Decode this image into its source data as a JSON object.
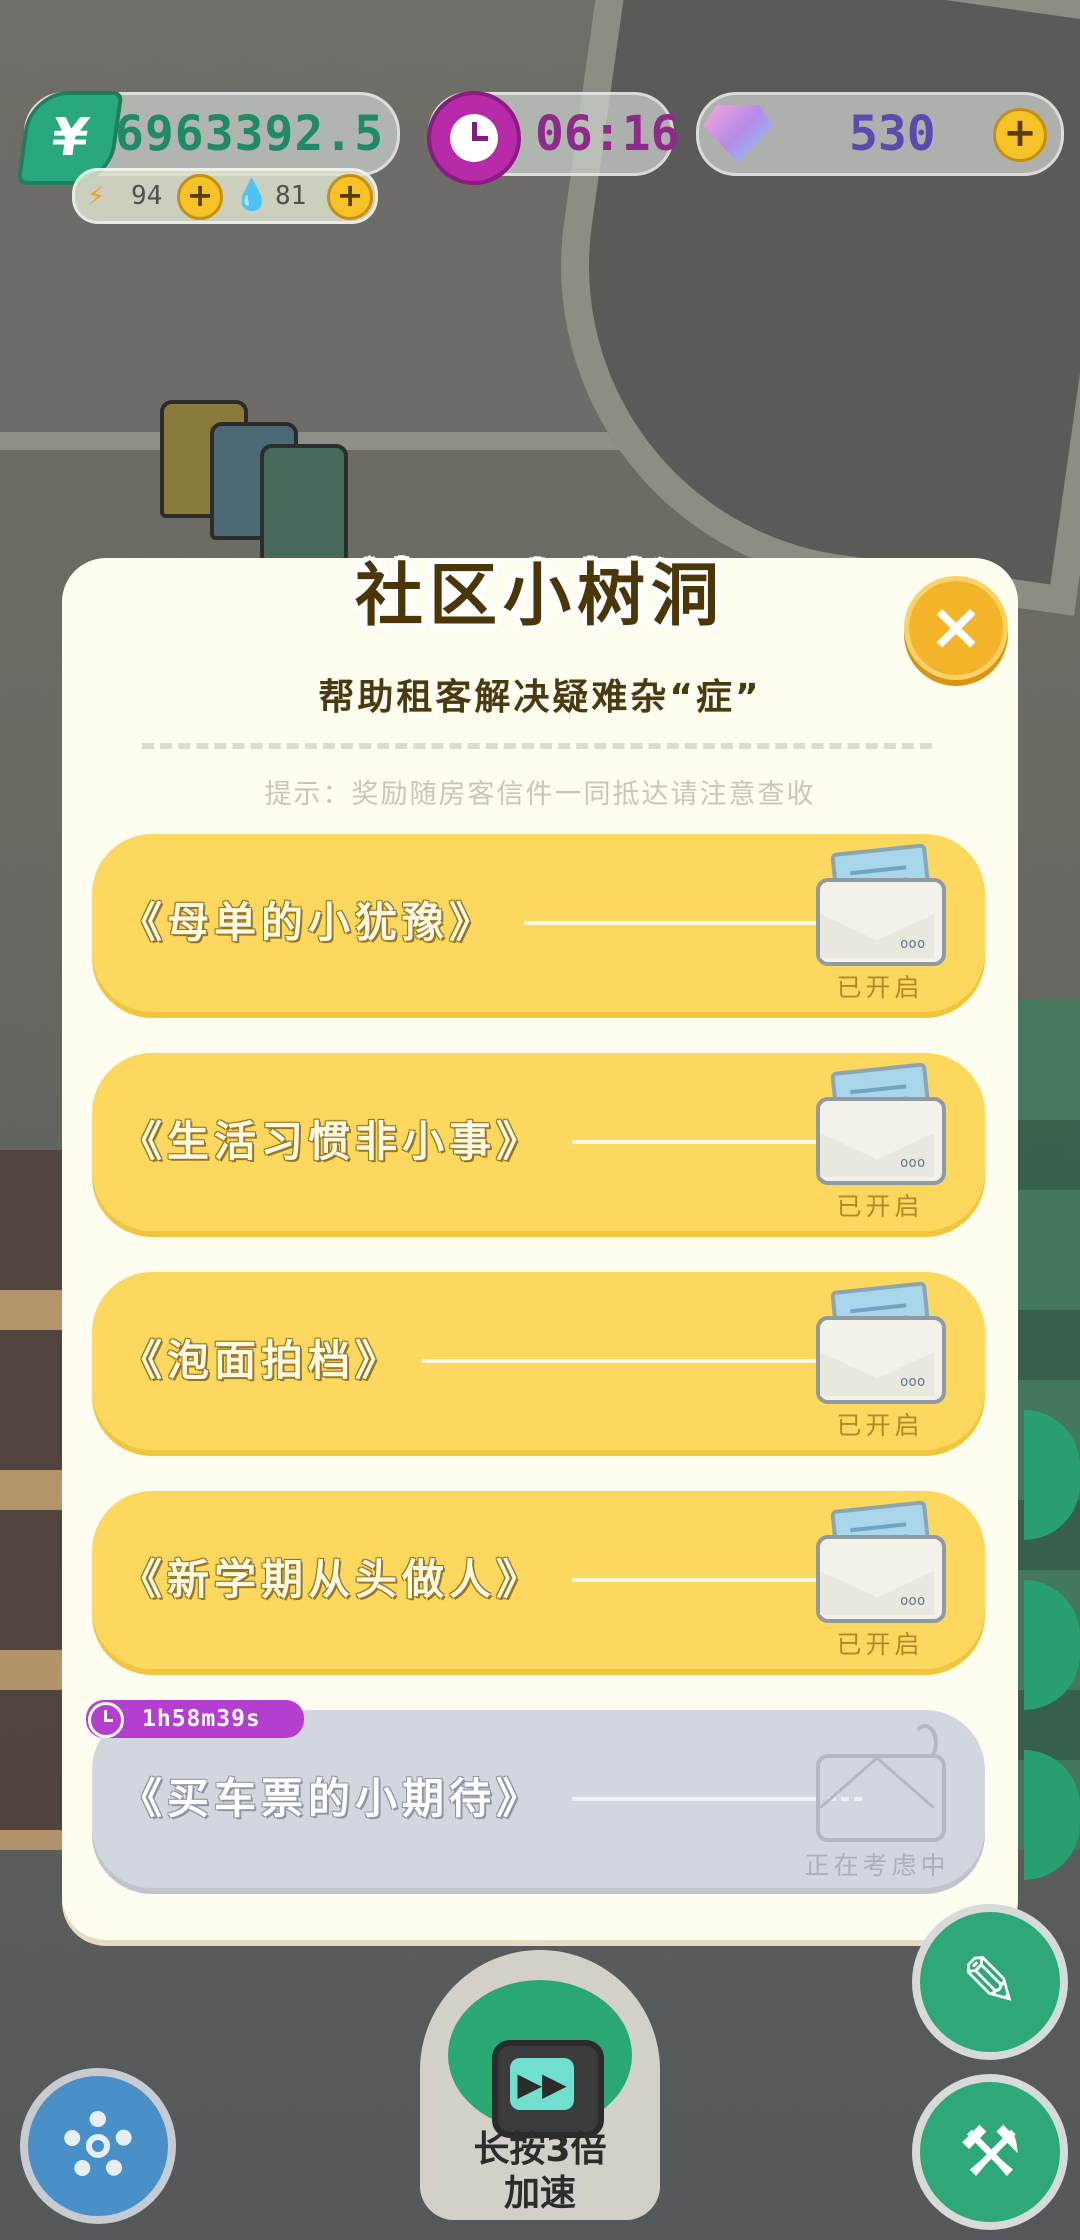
{
  "hud": {
    "money": {
      "icon": "yuan-icon",
      "symbol": "¥",
      "value": "6963392.5"
    },
    "timer": {
      "icon": "clock-icon",
      "value": "06:16"
    },
    "gems": {
      "icon": "gem-icon",
      "value": "530"
    },
    "energy": {
      "icon": "lightning-icon",
      "value": "94"
    },
    "water": {
      "icon": "water-drop-icon",
      "value": "81"
    },
    "plus_label": "+"
  },
  "modal": {
    "title": "社区小树洞",
    "close_label": "×",
    "subtitle": "帮助租客解决疑难杂“症”",
    "hint": "提示：奖励随房客信件一同抵达请注意查收",
    "letters": [
      {
        "title": "《母单的小犹豫》",
        "status": "已开启",
        "state": "opened"
      },
      {
        "title": "《生活习惯非小事》",
        "status": "已开启",
        "state": "opened"
      },
      {
        "title": "《泡面拍档》",
        "status": "已开启",
        "state": "opened"
      },
      {
        "title": "《新学期从头做人》",
        "status": "已开启",
        "state": "opened"
      },
      {
        "title": "《买车票的小期待》",
        "status": "正在考虑中",
        "state": "pending",
        "timer": "1h58m39s"
      }
    ],
    "envelope_dots": "ooo"
  },
  "controls": {
    "settings_icon": "gear-icon",
    "speed_up": {
      "icon": "tv-fast-forward-icon",
      "label_line1": "长按3倍",
      "label_line2": "加速"
    },
    "pen_icon": "pen-icon",
    "tools_icon": "hammer-wrench-icon"
  },
  "colors": {
    "card_opened": "#fcd85f",
    "card_pending": "#d2d6df",
    "timer_badge": "#b33ed0",
    "close_button": "#f5b52a",
    "money_green": "#2aa87d"
  }
}
